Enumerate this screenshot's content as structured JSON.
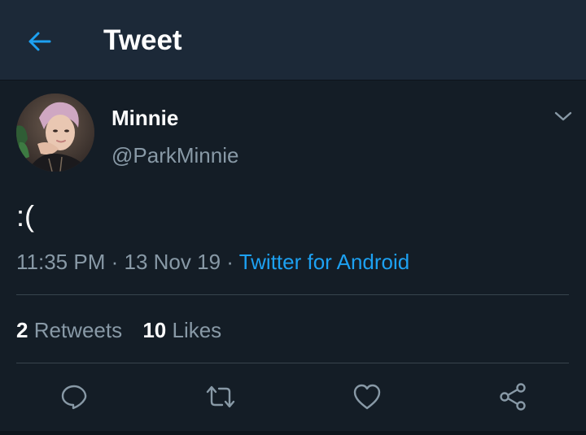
{
  "header": {
    "title": "Tweet",
    "back_icon": "arrow-left-icon"
  },
  "colors": {
    "background": "#141d26",
    "header_background": "#1c2938",
    "accent": "#1da1f2",
    "secondary_text": "#8899a6",
    "divider": "#38444d"
  },
  "tweet": {
    "author": {
      "display_name": "Minnie",
      "handle": "@ParkMinnie"
    },
    "text": ":(",
    "time": "11:35 PM",
    "separator": "·",
    "date": "13 Nov 19",
    "source": "Twitter for Android"
  },
  "stats": {
    "retweets_count": "2",
    "retweets_label": "Retweets",
    "likes_count": "10",
    "likes_label": "Likes"
  },
  "actions": [
    {
      "icon": "reply-icon"
    },
    {
      "icon": "retweet-icon"
    },
    {
      "icon": "heart-icon"
    },
    {
      "icon": "share-icon"
    }
  ]
}
